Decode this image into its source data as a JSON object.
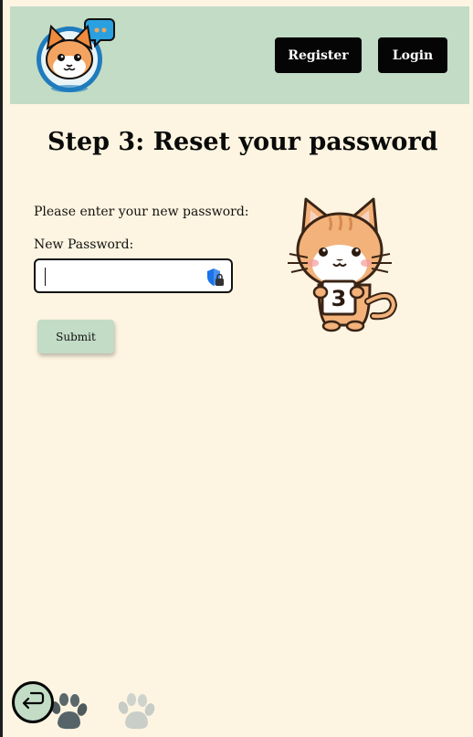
{
  "header": {
    "logo_icon": "cat-chat-bubble-logo",
    "register_label": "Register",
    "login_label": "Login"
  },
  "main": {
    "title": "Step 3: Reset your password",
    "instructions": "Please enter your new password:",
    "password_label": "New Password:",
    "password_value": "",
    "submit_label": "Submit",
    "illustration_badge": "3",
    "illustration_icon": "cat-holding-number-sign"
  },
  "footer": {
    "back_icon": "return-arrow-icon",
    "paw_icons": [
      "paw-print-dark-icon",
      "paw-print-light-icon"
    ]
  },
  "colors": {
    "page_background": "#fdf5e1",
    "header_background": "#c2dcc6",
    "button_dark": "#050505",
    "submit_background": "#c2dcc6"
  }
}
